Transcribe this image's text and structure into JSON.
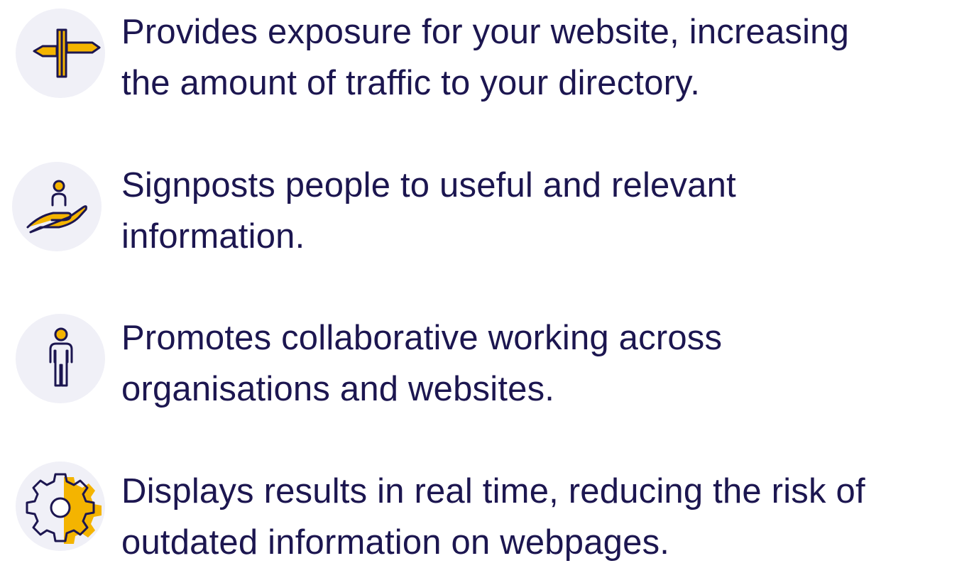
{
  "colors": {
    "text": "#1c1650",
    "accent": "#f4b400",
    "icon_background": "#f0f0f7"
  },
  "benefits": [
    {
      "icon": "signpost-icon",
      "lines": [
        "Provides exposure for your website, increasing",
        "the amount of traffic to your directory."
      ]
    },
    {
      "icon": "hand-holding-person-icon",
      "lines": [
        "Signposts people to useful and relevant",
        "information."
      ]
    },
    {
      "icon": "person-icon",
      "lines": [
        "Promotes collaborative working across",
        "organisations and websites."
      ]
    },
    {
      "icon": "gear-icon",
      "lines": [
        "Displays results in real time, reducing the risk of",
        "outdated information on webpages."
      ]
    }
  ]
}
